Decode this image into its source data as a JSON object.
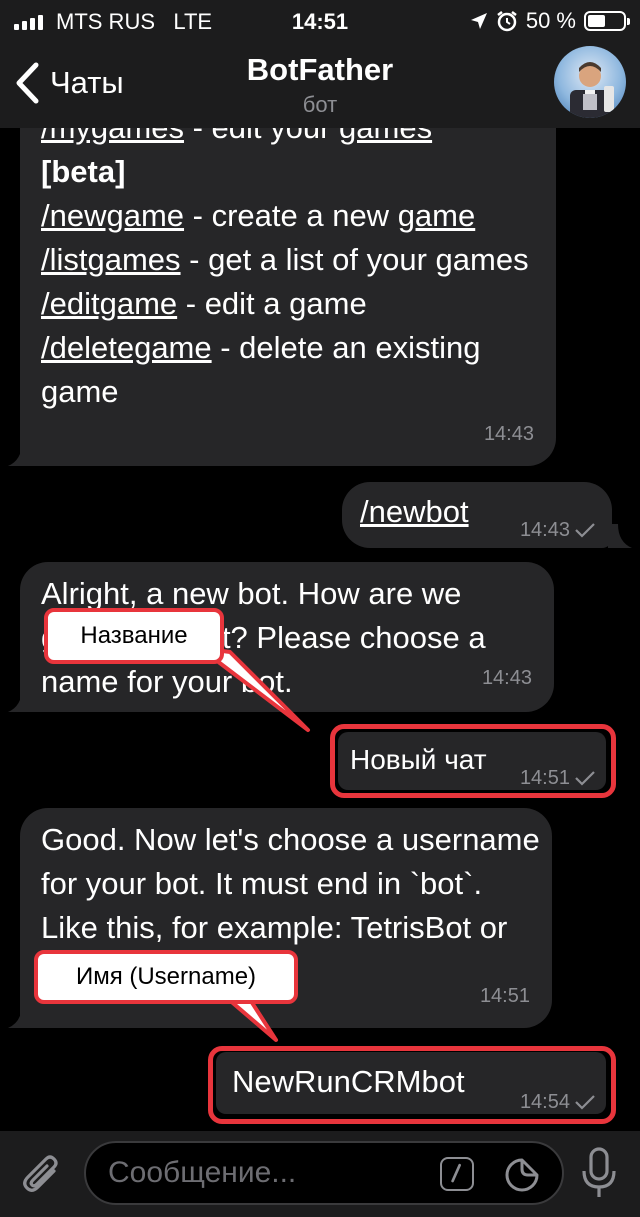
{
  "status_bar": {
    "carrier": "MTS RUS",
    "network": "LTE",
    "time": "14:51",
    "battery_text": "50 %",
    "battery_level": 0.5
  },
  "nav": {
    "back_label": "Чаты",
    "title": "BotFather",
    "subtitle": "бот"
  },
  "messages": {
    "m1": {
      "cmd_mygames": "/mygames",
      "mygames_rest_a": " - edit your ",
      "mygames_rest_b": "games",
      "beta": "[beta]",
      "cmd_newgame": "/newgame",
      "newgame_rest": " - create a new ",
      "newgame_word": "game",
      "cmd_listgames": "/listgames",
      "listgames_rest": " - get a list of your games",
      "cmd_editgame": "/editgame",
      "editgame_rest": " - edit a game",
      "cmd_deletegame": "/deletegame",
      "deletegame_rest": " - delete an existing game",
      "time": "14:43"
    },
    "m2": {
      "text": "/newbot",
      "time": "14:43"
    },
    "m3": {
      "text": "Alright, a new bot. How are we going to call it? Please choose a name for your bot.",
      "time": "14:43"
    },
    "m4": {
      "text": "Новый чат",
      "time": "14:51"
    },
    "m5": {
      "text": "Good. Now let's choose a username for your bot. It must end in `bot`. Like this, for example: TetrisBot or tetris_bot.",
      "time": "14:51"
    },
    "m6": {
      "text": "NewRunCRMbot",
      "time": "14:54"
    }
  },
  "annotations": {
    "name_label": "Название",
    "username_label": "Имя (Username)",
    "color": "#e8353c"
  },
  "input": {
    "placeholder": "Сообщение..."
  },
  "icons": [
    "chevron-left-icon",
    "paperclip-icon",
    "command-icon",
    "sticker-icon",
    "microphone-icon",
    "check-icon"
  ]
}
